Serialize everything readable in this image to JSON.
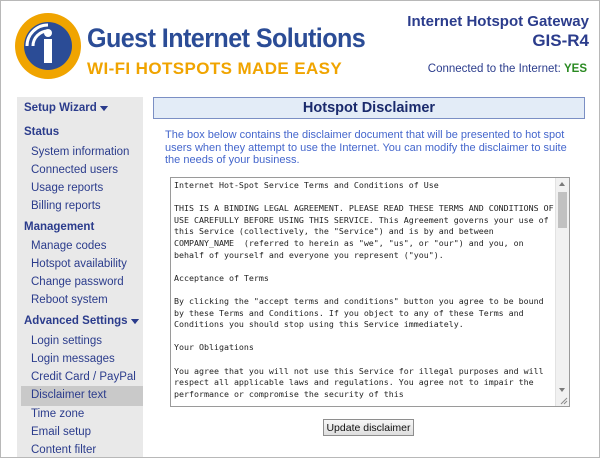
{
  "brand": {
    "name": "Guest Internet Solutions",
    "tagline": "WI-FI HOTSPOTS MADE EASY",
    "logo_letters": "GIS",
    "colors": {
      "blue": "#2b4c96",
      "orange": "#f0a400"
    }
  },
  "product": {
    "name": "Internet Hotspot Gateway",
    "model": "GIS-R4"
  },
  "connection": {
    "label": "Connected to the Internet:",
    "status": "YES",
    "status_color": "#2a8a22"
  },
  "sidebar": {
    "setup_wizard": "Setup Wizard",
    "status_heading": "Status",
    "status_items": [
      "System information",
      "Connected users",
      "Usage reports",
      "Billing reports"
    ],
    "management_heading": "Management",
    "management_items": [
      "Manage codes",
      "Hotspot availability",
      "Change password",
      "Reboot system"
    ],
    "advanced_heading": "Advanced Settings",
    "advanced_items": [
      "Login settings",
      "Login messages",
      "Credit Card / PayPal",
      "Disclaimer text",
      "Time zone",
      "Email setup",
      "Content filter"
    ],
    "selected": "Disclaimer text"
  },
  "main": {
    "title": "Hotspot Disclaimer",
    "intro": "The box below contains the disclaimer document that will be presented to hot spot users when they attempt to use the Internet. You can modify the disclaimer to suite the needs of your business.",
    "disclaimer_text": "Internet Hot-Spot Service Terms and Conditions of Use\n\nTHIS IS A BINDING LEGAL AGREEMENT. PLEASE READ THESE TERMS AND CONDITIONS OF USE CAREFULLY BEFORE USING THIS SERVICE. This Agreement governs your use of this Service (collectively, the \"Service\") and is by and between  COMPANY_NAME  (referred to herein as \"we\", \"us\", or \"our\") and you, on behalf of yourself and everyone you represent (\"you\").\n\nAcceptance of Terms\n\nBy clicking the \"accept terms and conditions\" button you agree to be bound by these Terms and Conditions. If you object to any of these Terms and Conditions you should stop using this Service immediately.\n\nYour Obligations\n\nYou agree that you will not use this Service for illegal purposes and will respect all applicable laws and regulations. You agree not to impair the performance or compromise the security of this",
    "update_button": "Update disclaimer"
  }
}
